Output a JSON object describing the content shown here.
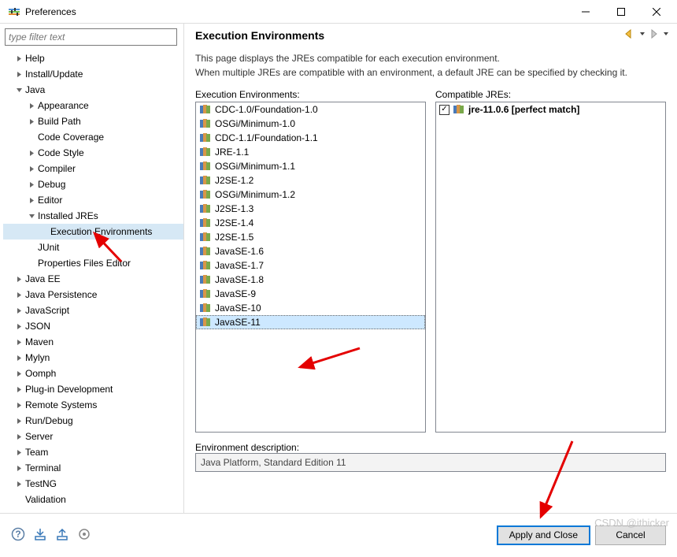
{
  "window": {
    "title": "Preferences"
  },
  "filter": {
    "placeholder": "type filter text"
  },
  "tree": [
    {
      "label": "Help",
      "depth": 0,
      "twisty": ">"
    },
    {
      "label": "Install/Update",
      "depth": 0,
      "twisty": ">"
    },
    {
      "label": "Java",
      "depth": 0,
      "twisty": "v"
    },
    {
      "label": "Appearance",
      "depth": 1,
      "twisty": ">"
    },
    {
      "label": "Build Path",
      "depth": 1,
      "twisty": ">"
    },
    {
      "label": "Code Coverage",
      "depth": 1,
      "twisty": ""
    },
    {
      "label": "Code Style",
      "depth": 1,
      "twisty": ">"
    },
    {
      "label": "Compiler",
      "depth": 1,
      "twisty": ">"
    },
    {
      "label": "Debug",
      "depth": 1,
      "twisty": ">"
    },
    {
      "label": "Editor",
      "depth": 1,
      "twisty": ">"
    },
    {
      "label": "Installed JREs",
      "depth": 1,
      "twisty": "v"
    },
    {
      "label": "Execution Environments",
      "depth": 2,
      "twisty": "",
      "selected": true
    },
    {
      "label": "JUnit",
      "depth": 1,
      "twisty": ""
    },
    {
      "label": "Properties Files Editor",
      "depth": 1,
      "twisty": ""
    },
    {
      "label": "Java EE",
      "depth": 0,
      "twisty": ">"
    },
    {
      "label": "Java Persistence",
      "depth": 0,
      "twisty": ">"
    },
    {
      "label": "JavaScript",
      "depth": 0,
      "twisty": ">"
    },
    {
      "label": "JSON",
      "depth": 0,
      "twisty": ">"
    },
    {
      "label": "Maven",
      "depth": 0,
      "twisty": ">"
    },
    {
      "label": "Mylyn",
      "depth": 0,
      "twisty": ">"
    },
    {
      "label": "Oomph",
      "depth": 0,
      "twisty": ">"
    },
    {
      "label": "Plug-in Development",
      "depth": 0,
      "twisty": ">"
    },
    {
      "label": "Remote Systems",
      "depth": 0,
      "twisty": ">"
    },
    {
      "label": "Run/Debug",
      "depth": 0,
      "twisty": ">"
    },
    {
      "label": "Server",
      "depth": 0,
      "twisty": ">"
    },
    {
      "label": "Team",
      "depth": 0,
      "twisty": ">"
    },
    {
      "label": "Terminal",
      "depth": 0,
      "twisty": ">"
    },
    {
      "label": "TestNG",
      "depth": 0,
      "twisty": ">"
    },
    {
      "label": "Validation",
      "depth": 0,
      "twisty": ""
    }
  ],
  "page": {
    "heading": "Execution Environments",
    "desc1": "This page displays the JREs compatible for each execution environment.",
    "desc2": "When multiple JREs are compatible with an environment, a default JRE can be specified by checking it.",
    "envs_label": "Execution Environments:",
    "compat_label": "Compatible JREs:",
    "env_desc_label": "Environment description:",
    "env_desc_value": "Java Platform, Standard Edition 11"
  },
  "envs": [
    {
      "label": "CDC-1.0/Foundation-1.0"
    },
    {
      "label": "OSGi/Minimum-1.0"
    },
    {
      "label": "CDC-1.1/Foundation-1.1"
    },
    {
      "label": "JRE-1.1"
    },
    {
      "label": "OSGi/Minimum-1.1"
    },
    {
      "label": "J2SE-1.2"
    },
    {
      "label": "OSGi/Minimum-1.2"
    },
    {
      "label": "J2SE-1.3"
    },
    {
      "label": "J2SE-1.4"
    },
    {
      "label": "J2SE-1.5"
    },
    {
      "label": "JavaSE-1.6"
    },
    {
      "label": "JavaSE-1.7"
    },
    {
      "label": "JavaSE-1.8"
    },
    {
      "label": "JavaSE-9"
    },
    {
      "label": "JavaSE-10"
    },
    {
      "label": "JavaSE-11",
      "selected": true
    }
  ],
  "compat": [
    {
      "label": "jre-11.0.6 [perfect match]",
      "checked": true,
      "bold": true
    }
  ],
  "buttons": {
    "apply": "Apply and Close",
    "cancel": "Cancel"
  },
  "watermark": "CSDN @ithicker"
}
